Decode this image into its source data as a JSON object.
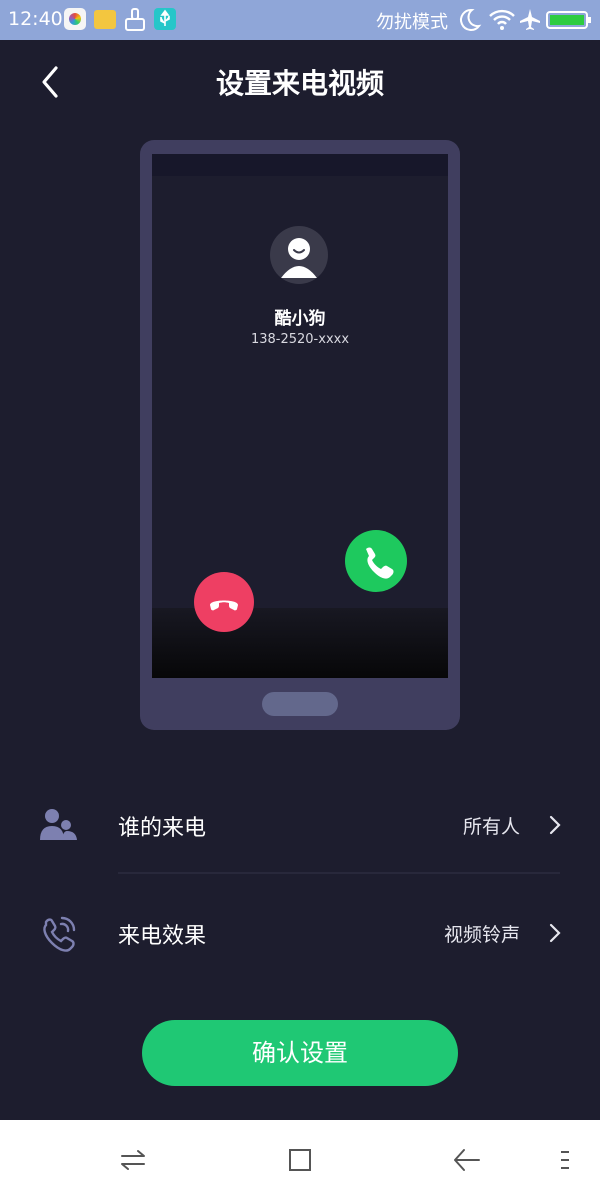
{
  "status_bar": {
    "time": "12:40",
    "dnd_text": "勿扰模式",
    "icons": [
      "photos-app-icon",
      "folder-app-icon",
      "cleaner-app-icon",
      "usb-icon",
      "moon-icon",
      "wifi-icon",
      "airplane-icon",
      "battery-icon"
    ],
    "battery_color": "#2ecc40"
  },
  "header": {
    "title": "设置来电视频",
    "back_icon": "chevron-left-icon"
  },
  "preview": {
    "caller_name": "酷小狗",
    "caller_number": "138-2520-xxxx",
    "decline_color": "#ee3f63",
    "answer_color": "#1ec95e"
  },
  "settings": [
    {
      "icon": "contacts-icon",
      "label": "谁的来电",
      "value": "所有人"
    },
    {
      "icon": "phone-ring-icon",
      "label": "来电效果",
      "value": "视频铃声"
    }
  ],
  "confirm_label": "确认设置",
  "accent_color": "#1fc874",
  "nav_bar": {
    "icons": [
      "switch-apps-icon",
      "home-square-icon",
      "back-arrow-icon",
      "menu-icon"
    ]
  }
}
